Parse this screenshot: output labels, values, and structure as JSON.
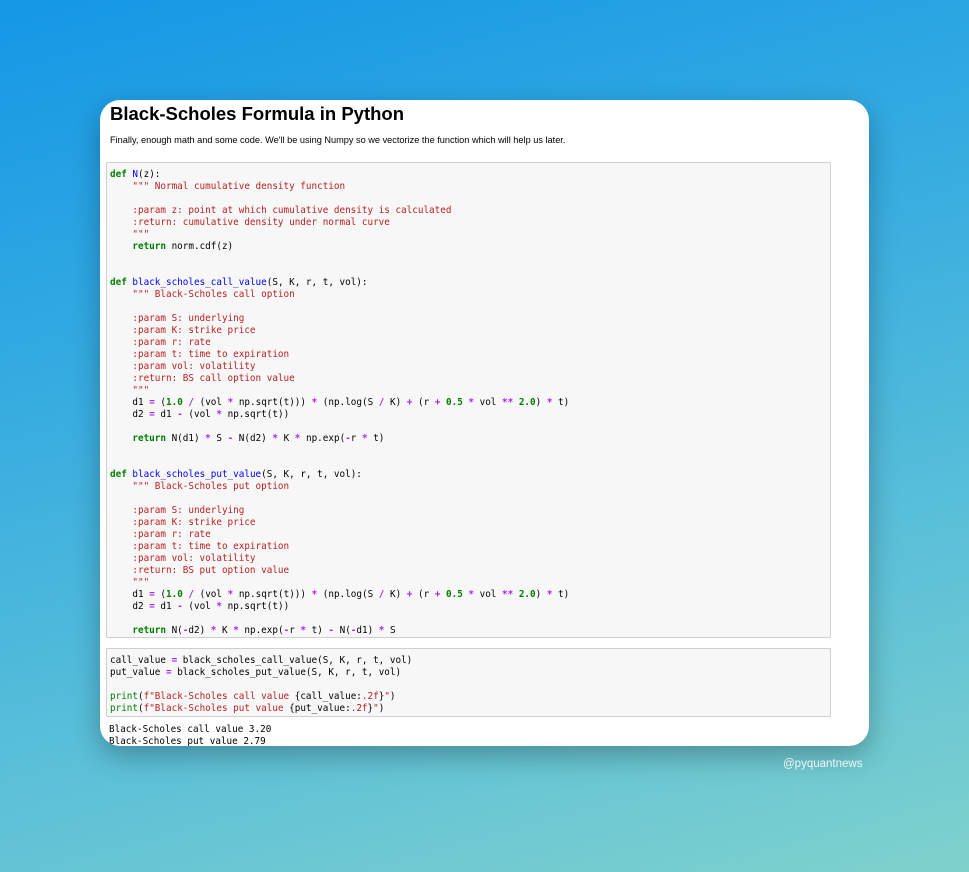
{
  "card": {
    "title": "Black-Scholes Formula in Python",
    "description": "Finally, enough math and some code. We'll be using Numpy so we vectorize the function which will help us later."
  },
  "code_cell_1": {
    "lines": [
      [
        [
          "kw",
          "def"
        ],
        [
          "t",
          " "
        ],
        [
          "fn",
          "N"
        ],
        [
          "t",
          "(z):"
        ]
      ],
      [
        [
          "t",
          "    "
        ],
        [
          "st",
          "\"\"\" Normal cumulative density function"
        ]
      ],
      [],
      [
        [
          "t",
          "    "
        ],
        [
          "st",
          ":param z: point at which cumulative density is calculated"
        ]
      ],
      [
        [
          "t",
          "    "
        ],
        [
          "st",
          ":return: cumulative density under normal curve"
        ]
      ],
      [
        [
          "t",
          "    "
        ],
        [
          "st",
          "\"\"\""
        ]
      ],
      [
        [
          "t",
          "    "
        ],
        [
          "kw",
          "return"
        ],
        [
          "t",
          " norm.cdf(z)"
        ]
      ],
      [],
      [],
      [
        [
          "kw",
          "def"
        ],
        [
          "t",
          " "
        ],
        [
          "fn",
          "black_scholes_call_value"
        ],
        [
          "t",
          "(S, K, r, t, vol):"
        ]
      ],
      [
        [
          "t",
          "    "
        ],
        [
          "st",
          "\"\"\" Black-Scholes call option"
        ]
      ],
      [],
      [
        [
          "t",
          "    "
        ],
        [
          "st",
          ":param S: underlying"
        ]
      ],
      [
        [
          "t",
          "    "
        ],
        [
          "st",
          ":param K: strike price"
        ]
      ],
      [
        [
          "t",
          "    "
        ],
        [
          "st",
          ":param r: rate"
        ]
      ],
      [
        [
          "t",
          "    "
        ],
        [
          "st",
          ":param t: time to expiration"
        ]
      ],
      [
        [
          "t",
          "    "
        ],
        [
          "st",
          ":param vol: volatility"
        ]
      ],
      [
        [
          "t",
          "    "
        ],
        [
          "st",
          ":return: BS call option value"
        ]
      ],
      [
        [
          "t",
          "    "
        ],
        [
          "st",
          "\"\"\""
        ]
      ],
      [
        [
          "t",
          "    d1 "
        ],
        [
          "op",
          "="
        ],
        [
          "t",
          " ("
        ],
        [
          "nm",
          "1.0"
        ],
        [
          "t",
          " "
        ],
        [
          "op",
          "/"
        ],
        [
          "t",
          " (vol "
        ],
        [
          "op",
          "*"
        ],
        [
          "t",
          " np.sqrt(t))) "
        ],
        [
          "op",
          "*"
        ],
        [
          "t",
          " (np.log(S "
        ],
        [
          "op",
          "/"
        ],
        [
          "t",
          " K) "
        ],
        [
          "op",
          "+"
        ],
        [
          "t",
          " (r "
        ],
        [
          "op",
          "+"
        ],
        [
          "t",
          " "
        ],
        [
          "nm",
          "0.5"
        ],
        [
          "t",
          " "
        ],
        [
          "op",
          "*"
        ],
        [
          "t",
          " vol "
        ],
        [
          "op",
          "**"
        ],
        [
          "t",
          " "
        ],
        [
          "nm",
          "2.0"
        ],
        [
          "t",
          ") "
        ],
        [
          "op",
          "*"
        ],
        [
          "t",
          " t)"
        ]
      ],
      [
        [
          "t",
          "    d2 "
        ],
        [
          "op",
          "="
        ],
        [
          "t",
          " d1 "
        ],
        [
          "op",
          "-"
        ],
        [
          "t",
          " (vol "
        ],
        [
          "op",
          "*"
        ],
        [
          "t",
          " np.sqrt(t))"
        ]
      ],
      [],
      [
        [
          "t",
          "    "
        ],
        [
          "kw",
          "return"
        ],
        [
          "t",
          " N(d1) "
        ],
        [
          "op",
          "*"
        ],
        [
          "t",
          " S "
        ],
        [
          "op",
          "-"
        ],
        [
          "t",
          " N(d2) "
        ],
        [
          "op",
          "*"
        ],
        [
          "t",
          " K "
        ],
        [
          "op",
          "*"
        ],
        [
          "t",
          " np.exp("
        ],
        [
          "op",
          "-"
        ],
        [
          "t",
          "r "
        ],
        [
          "op",
          "*"
        ],
        [
          "t",
          " t)"
        ]
      ],
      [],
      [],
      [
        [
          "kw",
          "def"
        ],
        [
          "t",
          " "
        ],
        [
          "fn",
          "black_scholes_put_value"
        ],
        [
          "t",
          "(S, K, r, t, vol):"
        ]
      ],
      [
        [
          "t",
          "    "
        ],
        [
          "st",
          "\"\"\" Black-Scholes put option"
        ]
      ],
      [],
      [
        [
          "t",
          "    "
        ],
        [
          "st",
          ":param S: underlying"
        ]
      ],
      [
        [
          "t",
          "    "
        ],
        [
          "st",
          ":param K: strike price"
        ]
      ],
      [
        [
          "t",
          "    "
        ],
        [
          "st",
          ":param r: rate"
        ]
      ],
      [
        [
          "t",
          "    "
        ],
        [
          "st",
          ":param t: time to expiration"
        ]
      ],
      [
        [
          "t",
          "    "
        ],
        [
          "st",
          ":param vol: volatility"
        ]
      ],
      [
        [
          "t",
          "    "
        ],
        [
          "st",
          ":return: BS put option value"
        ]
      ],
      [
        [
          "t",
          "    "
        ],
        [
          "st",
          "\"\"\""
        ]
      ],
      [
        [
          "t",
          "    d1 "
        ],
        [
          "op",
          "="
        ],
        [
          "t",
          " ("
        ],
        [
          "nm",
          "1.0"
        ],
        [
          "t",
          " "
        ],
        [
          "op",
          "/"
        ],
        [
          "t",
          " (vol "
        ],
        [
          "op",
          "*"
        ],
        [
          "t",
          " np.sqrt(t))) "
        ],
        [
          "op",
          "*"
        ],
        [
          "t",
          " (np.log(S "
        ],
        [
          "op",
          "/"
        ],
        [
          "t",
          " K) "
        ],
        [
          "op",
          "+"
        ],
        [
          "t",
          " (r "
        ],
        [
          "op",
          "+"
        ],
        [
          "t",
          " "
        ],
        [
          "nm",
          "0.5"
        ],
        [
          "t",
          " "
        ],
        [
          "op",
          "*"
        ],
        [
          "t",
          " vol "
        ],
        [
          "op",
          "**"
        ],
        [
          "t",
          " "
        ],
        [
          "nm",
          "2.0"
        ],
        [
          "t",
          ") "
        ],
        [
          "op",
          "*"
        ],
        [
          "t",
          " t)"
        ]
      ],
      [
        [
          "t",
          "    d2 "
        ],
        [
          "op",
          "="
        ],
        [
          "t",
          " d1 "
        ],
        [
          "op",
          "-"
        ],
        [
          "t",
          " (vol "
        ],
        [
          "op",
          "*"
        ],
        [
          "t",
          " np.sqrt(t))"
        ]
      ],
      [],
      [
        [
          "t",
          "    "
        ],
        [
          "kw",
          "return"
        ],
        [
          "t",
          " N("
        ],
        [
          "op",
          "-"
        ],
        [
          "t",
          "d2) "
        ],
        [
          "op",
          "*"
        ],
        [
          "t",
          " K "
        ],
        [
          "op",
          "*"
        ],
        [
          "t",
          " np.exp("
        ],
        [
          "op",
          "-"
        ],
        [
          "t",
          "r "
        ],
        [
          "op",
          "*"
        ],
        [
          "t",
          " t) "
        ],
        [
          "op",
          "-"
        ],
        [
          "t",
          " N("
        ],
        [
          "op",
          "-"
        ],
        [
          "t",
          "d1) "
        ],
        [
          "op",
          "*"
        ],
        [
          "t",
          " S"
        ]
      ]
    ]
  },
  "code_cell_2": {
    "lines": [
      [
        [
          "t",
          "call_value "
        ],
        [
          "op",
          "="
        ],
        [
          "t",
          " black_scholes_call_value(S, K, r, t, vol)"
        ]
      ],
      [
        [
          "t",
          "put_value "
        ],
        [
          "op",
          "="
        ],
        [
          "t",
          " black_scholes_put_value(S, K, r, t, vol)"
        ]
      ],
      [],
      [
        [
          "bi",
          "print"
        ],
        [
          "t",
          "("
        ],
        [
          "st",
          "f\"Black-Scholes call value "
        ],
        [
          "t",
          "{call_value:"
        ],
        [
          "st",
          ".2f"
        ],
        [
          "t",
          "}"
        ],
        [
          "st",
          "\""
        ],
        [
          "t",
          ")"
        ]
      ],
      [
        [
          "bi",
          "print"
        ],
        [
          "t",
          "("
        ],
        [
          "st",
          "f\"Black-Scholes put value "
        ],
        [
          "t",
          "{put_value:"
        ],
        [
          "st",
          ".2f"
        ],
        [
          "t",
          "}"
        ],
        [
          "st",
          "\""
        ],
        [
          "t",
          ")"
        ]
      ]
    ]
  },
  "output": {
    "line1": "Black-Scholes call value 3.20",
    "line2": "Black-Scholes put value 2.79"
  },
  "watermark": "@pyquantnews"
}
